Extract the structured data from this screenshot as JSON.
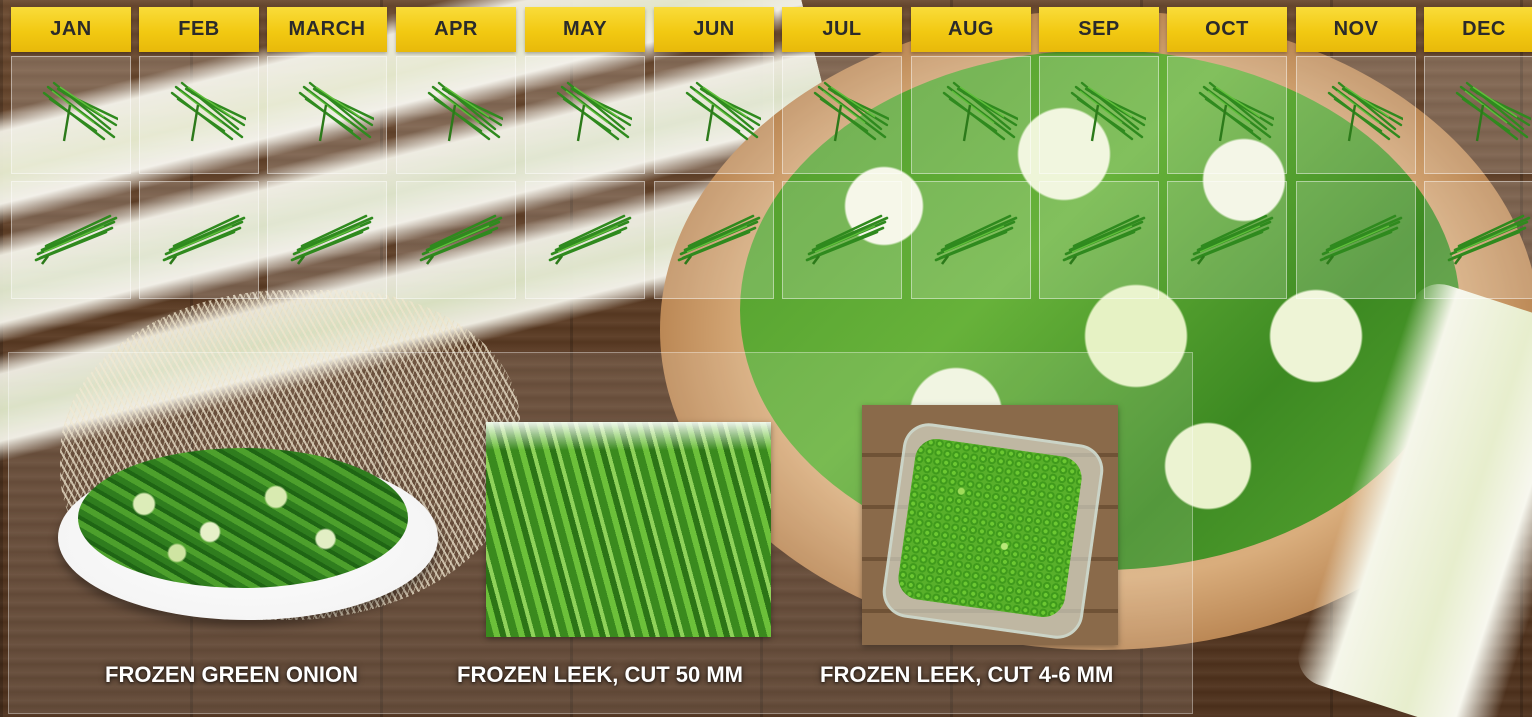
{
  "calendar": {
    "months": [
      {
        "label": "JAN"
      },
      {
        "label": "FEB"
      },
      {
        "label": "MARCH"
      },
      {
        "label": "APR"
      },
      {
        "label": "MAY"
      },
      {
        "label": "JUN"
      },
      {
        "label": "JUL"
      },
      {
        "label": "AUG"
      },
      {
        "label": "SEP"
      },
      {
        "label": "OCT"
      },
      {
        "label": "NOV"
      },
      {
        "label": "DEC"
      }
    ],
    "rows": [
      {
        "icon": "green-onion-sprig-icon",
        "available_months": [
          "JAN",
          "FEB",
          "MARCH",
          "APR",
          "MAY",
          "JUN",
          "JUL",
          "AUG",
          "SEP",
          "OCT",
          "NOV",
          "DEC"
        ]
      },
      {
        "icon": "leek-sprig-icon",
        "available_months": [
          "JAN",
          "FEB",
          "MARCH",
          "APR",
          "MAY",
          "JUN",
          "JUL",
          "AUG",
          "SEP",
          "OCT",
          "NOV",
          "DEC"
        ]
      }
    ],
    "header_color": "#F2C912"
  },
  "products": [
    {
      "label": "FROZEN GREEN ONION",
      "image": "green-onion-plate"
    },
    {
      "label": "FROZEN LEEK, CUT 50 MM",
      "image": "leek-cut-50mm-photo"
    },
    {
      "label": "FROZEN LEEK, CUT 4-6 MM",
      "image": "leek-cut-4-6mm-photo"
    }
  ]
}
